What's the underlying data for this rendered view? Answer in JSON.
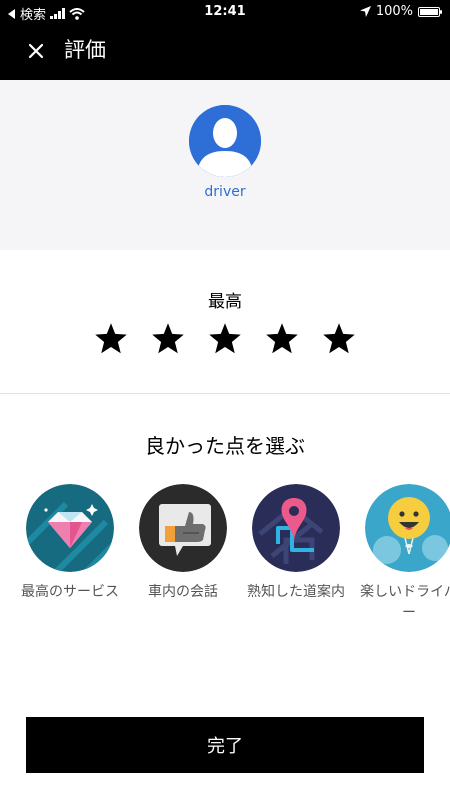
{
  "status_bar": {
    "back_app": "検索",
    "time": "12:41",
    "battery": "100%",
    "battery_level": 1.0
  },
  "header": {
    "title": "評価",
    "close_icon": "close-icon"
  },
  "profile": {
    "name": "driver",
    "avatar_icon": "person-silhouette-icon"
  },
  "rating": {
    "label": "最高",
    "value": 5,
    "max": 5
  },
  "compliments": {
    "title": "良かった点を選ぶ",
    "items": [
      {
        "label": "最高のサービス",
        "icon": "diamond-icon"
      },
      {
        "label": "車内の会話",
        "icon": "thumbs-up-icon"
      },
      {
        "label": "熟知した道案内",
        "icon": "map-pin-icon"
      },
      {
        "label": "楽しいドライバー",
        "icon": "smiley-balloon-icon"
      }
    ]
  },
  "done_button": {
    "label": "完了"
  },
  "colors": {
    "header_bg": "#000000",
    "profile_bg": "#f5f5f7",
    "accent_blue": "#2d6fd6"
  }
}
